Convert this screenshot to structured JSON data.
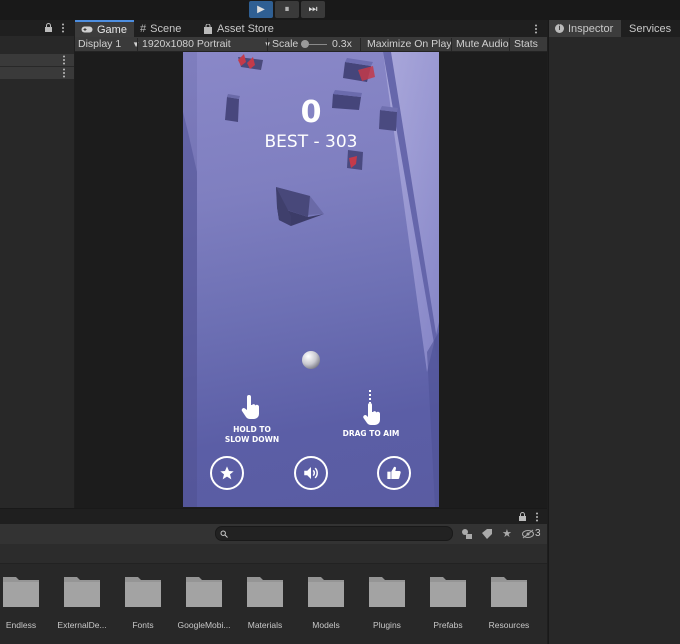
{
  "toolbar": {
    "play": "▶",
    "pause": "⏸",
    "step": "⏭"
  },
  "game_tabs": [
    {
      "label": "Game"
    },
    {
      "label": "Scene"
    },
    {
      "label": "Asset Store"
    }
  ],
  "game_controls": {
    "display": "Display 1",
    "resolution": "1920x1080 Portrait",
    "scale_label": "Scale",
    "scale_value": "0.3x",
    "maximize": "Maximize On Play",
    "mute": "Mute Audio",
    "stats": "Stats"
  },
  "game": {
    "score": "0",
    "best": "BEST - 303",
    "hint_hold": "HOLD TO\nSLOW DOWN",
    "hint_drag": "DRAG TO AIM"
  },
  "inspector_tabs": [
    {
      "label": "Inspector"
    },
    {
      "label": "Services"
    }
  ],
  "project": {
    "hidden_count": "3",
    "folders": [
      {
        "label": "Endless"
      },
      {
        "label": "ExternalDe..."
      },
      {
        "label": "Fonts"
      },
      {
        "label": "GoogleMobi..."
      },
      {
        "label": "Materials"
      },
      {
        "label": "Models"
      },
      {
        "label": "Plugins"
      },
      {
        "label": "Prefabs"
      },
      {
        "label": "Resources"
      }
    ]
  },
  "colors": {
    "accent": "#4d8ee0",
    "play_active": "#2f5f93",
    "game_top": "#8a88c8",
    "game_bottom": "#5a5ca2"
  }
}
